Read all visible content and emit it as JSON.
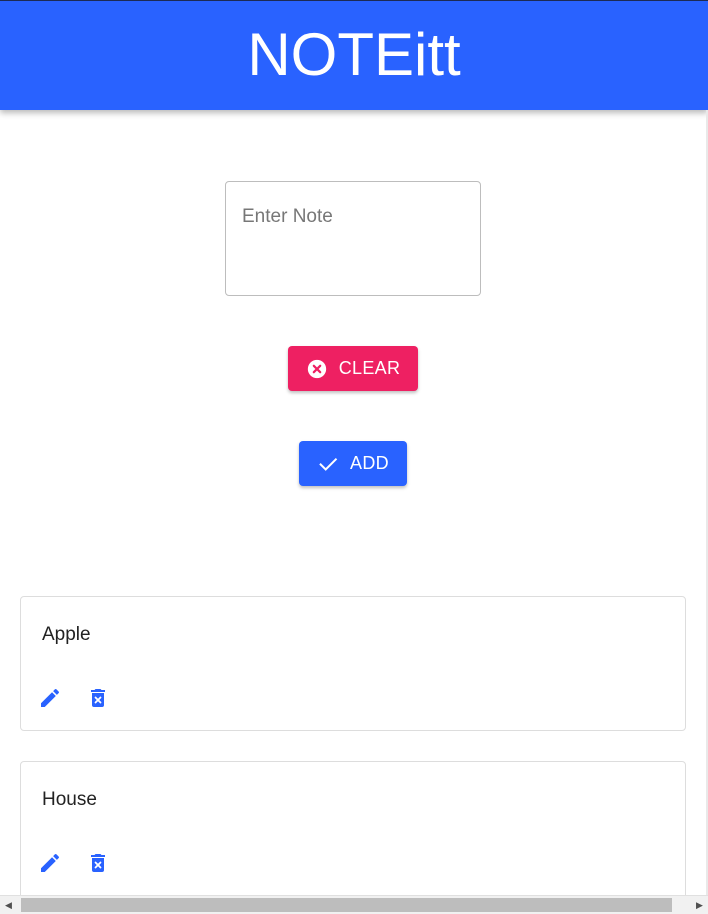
{
  "app": {
    "title": "NOTEitt"
  },
  "form": {
    "note_placeholder": "Enter Note",
    "note_value": "",
    "clear_label": "CLEAR",
    "add_label": "ADD"
  },
  "notes": [
    {
      "text": "Apple",
      "edit_icon": "pencil-icon",
      "delete_icon": "trash-icon"
    },
    {
      "text": "House",
      "edit_icon": "pencil-icon",
      "delete_icon": "trash-icon"
    }
  ],
  "colors": {
    "primary": "#2962ff",
    "clear": "#ee2062",
    "icon": "#2962ff",
    "text": "#222222"
  }
}
